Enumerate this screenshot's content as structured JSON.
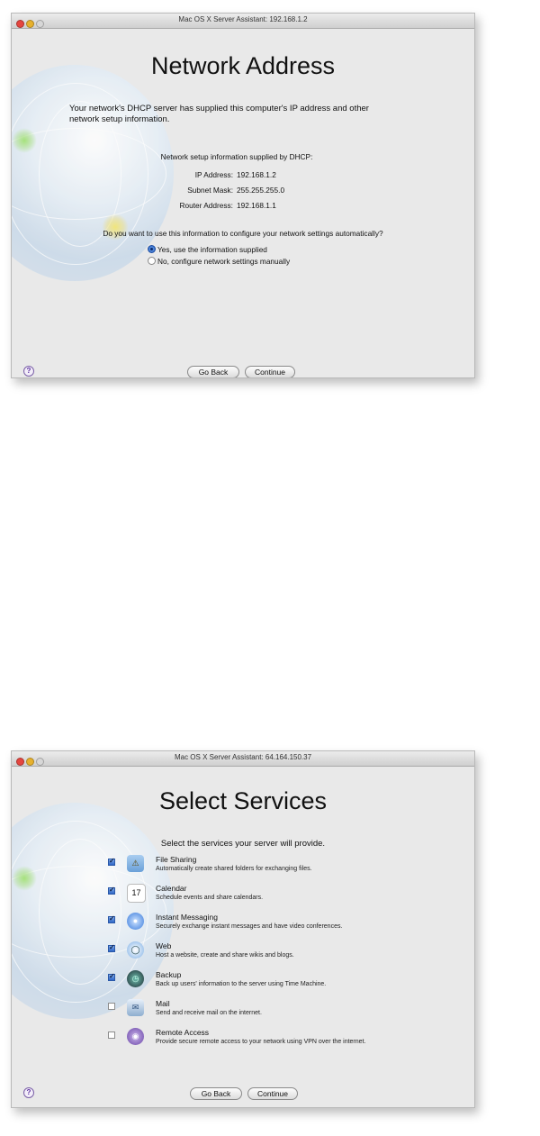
{
  "window1": {
    "title": "Mac OS X Server Assistant: 192.168.1.2",
    "heading": "Network Address",
    "intro_line1": "Your network's DHCP server has supplied this computer's IP address and other",
    "intro_line2": "network setup information.",
    "dhcp_header": "Network setup information supplied by DHCP:",
    "ip_label": "IP Address:",
    "ip_value": "192.168.1.2",
    "subnet_label": "Subnet Mask:",
    "subnet_value": "255.255.255.0",
    "router_label": "Router Address:",
    "router_value": "192.168.1.1",
    "question": "Do you want to use this information to configure your network settings automatically?",
    "options": [
      {
        "label": "Yes, use the information supplied",
        "selected": true
      },
      {
        "label": "No, configure network settings manually",
        "selected": false
      }
    ],
    "go_back": "Go Back",
    "continue": "Continue",
    "help": "?"
  },
  "window2": {
    "title": "Mac OS X Server Assistant: 64.164.150.37",
    "heading": "Select Services",
    "subheading": "Select the services your server will provide.",
    "services": [
      {
        "name": "File Sharing",
        "description": "Automatically create shared folders for exchanging files.",
        "checked": true,
        "icon": "folder-icon"
      },
      {
        "name": "Calendar",
        "description": "Schedule events and share calendars.",
        "checked": true,
        "icon": "calendar-icon"
      },
      {
        "name": "Instant Messaging",
        "description": "Securely exchange instant messages and have video conferences.",
        "checked": true,
        "icon": "chat-icon"
      },
      {
        "name": "Web",
        "description": "Host a website, create and share wikis and blogs.",
        "checked": true,
        "icon": "web-icon"
      },
      {
        "name": "Backup",
        "description": "Back up users' information to the server using Time Machine.",
        "checked": true,
        "icon": "time-machine-icon"
      },
      {
        "name": "Mail",
        "description": "Send and receive mail on the internet.",
        "checked": false,
        "icon": "mail-icon"
      },
      {
        "name": "Remote Access",
        "description": "Provide secure remote access to your network using VPN over the internet.",
        "checked": false,
        "icon": "remote-access-icon"
      }
    ],
    "calendar_day": "17",
    "go_back": "Go Back",
    "continue": "Continue",
    "help": "?"
  }
}
